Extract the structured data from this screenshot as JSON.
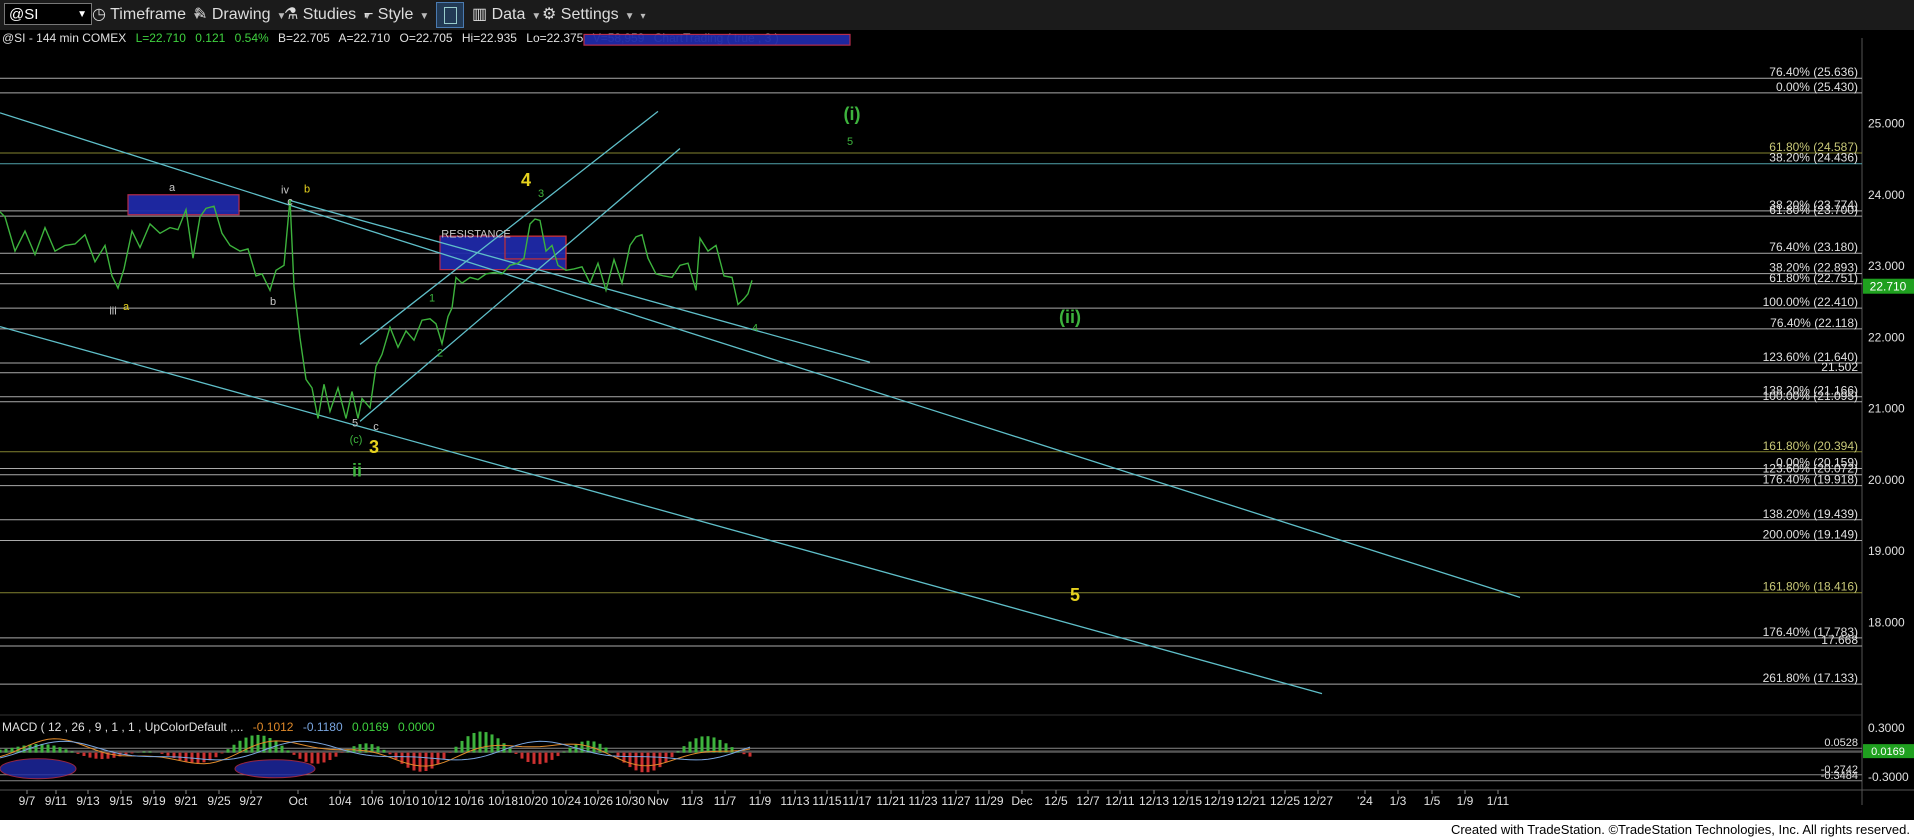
{
  "toolbar": {
    "symbol": "@SI",
    "timeframe_label": "Timeframe",
    "drawing_label": "Drawing",
    "studies_label": "Studies",
    "style_label": "Style",
    "data_label": "Data",
    "settings_label": "Settings"
  },
  "header": {
    "prefix": "@SI - 144 min  COMEX",
    "last": "L=22.710",
    "change": "0.121",
    "pct": "0.54%",
    "bid": "B=22.705",
    "ask": "A=22.710",
    "open": "O=22.705",
    "high": "Hi=22.935",
    "low": "Lo=22.375",
    "volume": "V=58,959",
    "charttrading": "ChartTrading ( true , 3 )"
  },
  "macd_header": {
    "label": "MACD ( 12 , 26 , 9 , 1 , 1 , UpColorDefault ,...",
    "v1": "-0.1012",
    "v2": "-0.1180",
    "v3": "0.0169",
    "v4": "0.0000"
  },
  "footer": "Created with TradeStation. ©TradeStation Technologies, Inc. All rights reserved.",
  "colors": {
    "cyan": "#5fbfc9",
    "green": "#3db33d",
    "yellow": "#e6d21e",
    "gray": "#c8c8c8",
    "olive": "#9a9a3a",
    "red": "#cc3030",
    "blue": "#1f2aa8"
  },
  "chart_data": {
    "type": "line",
    "price_ylim": [
      16.7,
      26.2
    ],
    "macd_ylim": [
      -0.4,
      0.4
    ],
    "x_tick_labels": [
      "9/7",
      "9/11",
      "9/13",
      "9/15",
      "9/19",
      "9/21",
      "9/25",
      "9/27",
      "Oct",
      "10/4",
      "10/6",
      "10/10",
      "10/12",
      "10/16",
      "10/18",
      "10/20",
      "10/24",
      "10/26",
      "10/30",
      "Nov",
      "11/3",
      "11/7",
      "11/9",
      "11/13",
      "11/15",
      "11/17",
      "11/21",
      "11/23",
      "11/27",
      "11/29",
      "Dec",
      "12/5",
      "12/7",
      "12/11",
      "12/13",
      "12/15",
      "12/19",
      "12/21",
      "12/25",
      "12/27",
      "'24",
      "1/3",
      "1/5",
      "1/9",
      "1/11"
    ],
    "price_axis_ticks": [
      25.0,
      24.0,
      23.0,
      22.0,
      21.0,
      20.0,
      19.0,
      18.0
    ],
    "price_axis_tick_labels": [
      "25.000",
      "24.000",
      "23.000",
      "22.000",
      "21.000",
      "20.000",
      "19.000",
      "18.000"
    ],
    "macd_axis_ticks": [
      0.3,
      -0.3
    ],
    "macd_axis_tick_labels": [
      "0.3000",
      "-0.3000"
    ],
    "series": [
      {
        "values": [
          [
            0,
            23.85
          ],
          [
            5,
            23.6
          ],
          [
            15,
            23.3
          ],
          [
            25,
            23.4
          ],
          [
            35,
            23.25
          ],
          [
            45,
            23.45
          ],
          [
            55,
            23.3
          ],
          [
            65,
            23.2
          ],
          [
            75,
            23.4
          ],
          [
            85,
            23.35
          ],
          [
            95,
            23.15
          ],
          [
            105,
            23.2
          ],
          [
            112,
            22.95
          ],
          [
            118,
            22.6
          ],
          [
            124,
            23.05
          ],
          [
            132,
            23.4
          ],
          [
            140,
            23.35
          ],
          [
            150,
            23.5
          ],
          [
            160,
            23.55
          ],
          [
            170,
            23.45
          ],
          [
            178,
            23.6
          ],
          [
            186,
            23.7
          ],
          [
            193,
            23.2
          ],
          [
            200,
            23.6
          ],
          [
            206,
            23.9
          ],
          [
            214,
            23.75
          ],
          [
            222,
            23.55
          ],
          [
            230,
            23.2
          ],
          [
            240,
            23.3
          ],
          [
            248,
            23.15
          ],
          [
            256,
            22.95
          ],
          [
            262,
            22.8
          ],
          [
            270,
            22.75
          ],
          [
            276,
            22.85
          ],
          [
            284,
            23.1
          ],
          [
            290,
            23.85
          ],
          [
            294,
            22.8
          ],
          [
            300,
            21.9
          ],
          [
            306,
            21.5
          ],
          [
            312,
            21.2
          ],
          [
            318,
            20.95
          ],
          [
            324,
            21.25
          ],
          [
            330,
            21.05
          ],
          [
            338,
            21.2
          ],
          [
            346,
            20.95
          ],
          [
            352,
            21.15
          ],
          [
            358,
            20.95
          ],
          [
            362,
            21.05
          ],
          [
            370,
            21.1
          ],
          [
            376,
            21.5
          ],
          [
            382,
            21.85
          ],
          [
            390,
            22.05
          ],
          [
            398,
            21.95
          ],
          [
            406,
            22.0
          ],
          [
            414,
            22.05
          ],
          [
            422,
            22.15
          ],
          [
            430,
            22.35
          ],
          [
            436,
            22.1
          ],
          [
            442,
            22.0
          ],
          [
            448,
            22.2
          ],
          [
            452,
            22.5
          ],
          [
            456,
            22.75
          ],
          [
            462,
            22.85
          ],
          [
            470,
            22.75
          ],
          [
            478,
            22.9
          ],
          [
            486,
            22.8
          ],
          [
            494,
            23.0
          ],
          [
            502,
            22.8
          ],
          [
            510,
            23.1
          ],
          [
            518,
            22.95
          ],
          [
            524,
            23.2
          ],
          [
            530,
            23.5
          ],
          [
            535,
            23.75
          ],
          [
            540,
            23.55
          ],
          [
            546,
            23.3
          ],
          [
            552,
            23.2
          ],
          [
            558,
            23.1
          ],
          [
            566,
            22.85
          ],
          [
            574,
            23.05
          ],
          [
            582,
            22.9
          ],
          [
            590,
            22.85
          ],
          [
            598,
            22.95
          ],
          [
            606,
            22.75
          ],
          [
            614,
            23.0
          ],
          [
            622,
            22.85
          ],
          [
            630,
            23.2
          ],
          [
            636,
            23.5
          ],
          [
            642,
            23.35
          ],
          [
            648,
            23.2
          ],
          [
            656,
            22.8
          ],
          [
            664,
            22.95
          ],
          [
            672,
            22.75
          ],
          [
            680,
            23.1
          ],
          [
            688,
            22.95
          ],
          [
            696,
            22.75
          ],
          [
            700,
            23.3
          ],
          [
            708,
            23.3
          ],
          [
            716,
            23.2
          ],
          [
            724,
            22.95
          ],
          [
            732,
            22.75
          ],
          [
            738,
            22.55
          ],
          [
            744,
            22.45
          ],
          [
            748,
            22.7
          ],
          [
            752,
            22.71
          ]
        ]
      }
    ],
    "fib_levels": [
      {
        "label": "76.40% (25.636)",
        "value": 25.636
      },
      {
        "label": "0.00% (25.430)",
        "value": 25.43
      },
      {
        "label": "61.80% (24.587)",
        "value": 24.587
      },
      {
        "label": "38.20% (24.436)",
        "value": 24.436
      },
      {
        "label": "38.20% (23.774)",
        "value": 23.774
      },
      {
        "label": "61.80% (23.700)",
        "value": 23.7
      },
      {
        "label": "76.40% (23.180)",
        "value": 23.18
      },
      {
        "label": "38.20% (22.893)",
        "value": 22.893
      },
      {
        "label": "61.80% (22.751)",
        "value": 22.751
      },
      {
        "label": "100.00% (22.410)",
        "value": 22.41
      },
      {
        "label": "76.40% (22.118)",
        "value": 22.118
      },
      {
        "label": "123.60% (21.640)",
        "value": 21.64
      },
      {
        "label": "21.502",
        "value": 21.502
      },
      {
        "label": "138.20% (21.166)",
        "value": 21.166
      },
      {
        "label": "100.00% (21.095)",
        "value": 21.095
      },
      {
        "label": "161.80% (20.394)",
        "value": 20.394
      },
      {
        "label": "0.00% (20.159)",
        "value": 20.159
      },
      {
        "label": "123.60% (20.072)",
        "value": 20.072
      },
      {
        "label": "176.40% (19.918)",
        "value": 19.918
      },
      {
        "label": "138.20% (19.439)",
        "value": 19.439
      },
      {
        "label": "200.00% (19.149)",
        "value": 19.149
      },
      {
        "label": "161.80% (18.416)",
        "value": 18.416
      },
      {
        "label": "176.40% (17.783)",
        "value": 17.783
      },
      {
        "label": "17.668",
        "value": 17.668
      },
      {
        "label": "261.80% (17.133)",
        "value": 17.133
      }
    ],
    "last_price_label": "22.710",
    "macd_levels": [
      {
        "label": "0.0528",
        "value": 0.0528
      },
      {
        "label": "0.0169",
        "value": 0.0169
      },
      {
        "label": "-0.2742",
        "value": -0.2742
      },
      {
        "label": "-0.3484",
        "value": -0.3484
      }
    ],
    "annotations": [
      {
        "text": "a",
        "x": 172,
        "y": 24.05,
        "color": "gray"
      },
      {
        "text": "iv",
        "x": 285,
        "y": 24.02,
        "color": "gray"
      },
      {
        "text": "b",
        "x": 307,
        "y": 24.03,
        "color": "yellow"
      },
      {
        "text": "c",
        "x": 290,
        "y": 23.86,
        "color": "gray"
      },
      {
        "text": "iii",
        "x": 113,
        "y": 22.32,
        "color": "gray"
      },
      {
        "text": "a",
        "x": 126,
        "y": 22.38,
        "color": "yellow"
      },
      {
        "text": "b",
        "x": 273,
        "y": 22.45,
        "color": "gray"
      },
      {
        "text": "1",
        "x": 432,
        "y": 22.5,
        "color": "green"
      },
      {
        "text": "2",
        "x": 440,
        "y": 21.73,
        "color": "green"
      },
      {
        "text": "5",
        "x": 355,
        "y": 20.75,
        "color": "gray"
      },
      {
        "text": "c",
        "x": 376,
        "y": 20.7,
        "color": "gray"
      },
      {
        "text": "(c)",
        "x": 356,
        "y": 20.52,
        "color": "green"
      },
      {
        "text": "3",
        "x": 374,
        "y": 20.38,
        "color": "yellow"
      },
      {
        "text": "ii",
        "x": 357,
        "y": 20.05,
        "color": "green"
      },
      {
        "text": "4",
        "x": 526,
        "y": 24.12,
        "color": "yellow"
      },
      {
        "text": "3",
        "x": 541,
        "y": 23.97,
        "color": "green"
      },
      {
        "text": "4",
        "x": 755,
        "y": 22.08,
        "color": "green"
      },
      {
        "text": "(i)",
        "x": 852,
        "y": 25.05,
        "color": "green"
      },
      {
        "text": "5",
        "x": 850,
        "y": 24.7,
        "color": "green"
      },
      {
        "text": "(ii)",
        "x": 1070,
        "y": 22.2,
        "color": "green"
      },
      {
        "text": "5",
        "x": 1075,
        "y": 18.3,
        "color": "yellow"
      },
      {
        "text": "RESISTANCE",
        "x": 476,
        "y": 23.4,
        "color": "gray"
      }
    ],
    "boxes": [
      {
        "x1": 128,
        "x2": 239,
        "y1": 24.0,
        "y2": 23.72,
        "color": "blue"
      },
      {
        "x1": 440,
        "x2": 566,
        "y1": 23.42,
        "y2": 22.95,
        "color": "blue"
      },
      {
        "x1": 505,
        "x2": 566,
        "y1": 23.42,
        "y2": 23.1,
        "color": "red"
      },
      {
        "x1": 584,
        "x2": 850,
        "y1": 26.25,
        "y2": 26.1,
        "color": "blue"
      }
    ],
    "trendlines": [
      {
        "x1": 0,
        "y1": 25.15,
        "x2": 1520,
        "y2": 18.35
      },
      {
        "x1": 0,
        "y1": 22.15,
        "x2": 1322,
        "y2": 17.0
      },
      {
        "x1": 290,
        "y1": 23.92,
        "x2": 870,
        "y2": 21.65
      },
      {
        "x1": 360,
        "y1": 21.9,
        "x2": 658,
        "y2": 25.17
      },
      {
        "x1": 360,
        "y1": 20.82,
        "x2": 680,
        "y2": 24.65
      }
    ]
  }
}
